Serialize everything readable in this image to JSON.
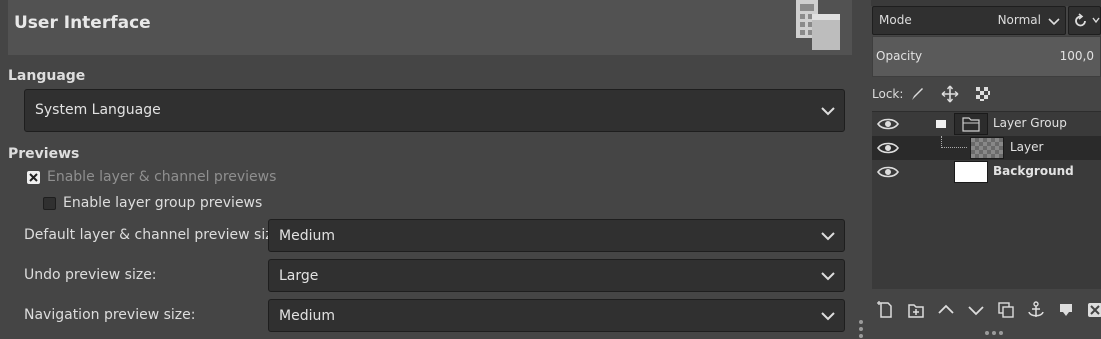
{
  "prefs": {
    "header": {
      "title": "User Interface",
      "icon": "interface-icon"
    },
    "language": {
      "section_label": "Language",
      "selected": "System Language"
    },
    "previews": {
      "section_label": "Previews",
      "enable_layer_channel_previews": {
        "label": "Enable layer & channel previews",
        "checked": true
      },
      "enable_layer_group_previews": {
        "label": "Enable layer group previews",
        "checked": false
      },
      "default_preview_size": {
        "label": "Default layer & channel preview size:",
        "value": "Medium"
      },
      "undo_preview_size": {
        "label": "Undo preview size:",
        "value": "Large"
      },
      "navigation_preview_size": {
        "label": "Navigation preview size:",
        "value": "Medium"
      }
    }
  },
  "layers_dock": {
    "mode_label": "Mode",
    "mode_value": "Normal",
    "opacity_label": "Opacity",
    "opacity_value": "100,0",
    "lock_label": "Lock:",
    "layers": [
      {
        "name": "Layer Group",
        "type": "group",
        "visible": true,
        "bold": false
      },
      {
        "name": "Layer",
        "type": "layer",
        "visible": true,
        "selected": true,
        "bold": false
      },
      {
        "name": "Background",
        "type": "background",
        "visible": true,
        "bold": true
      }
    ],
    "bottom_actions": [
      "new-layer-icon",
      "new-group-icon",
      "raise-icon",
      "lower-icon",
      "duplicate-icon",
      "anchor-icon",
      "merge-icon",
      "delete-icon"
    ]
  },
  "colors": {
    "panel_bg": "#454545",
    "field_bg": "#303030",
    "header_bg": "#525252",
    "selected_row": "#2a2a2a"
  }
}
